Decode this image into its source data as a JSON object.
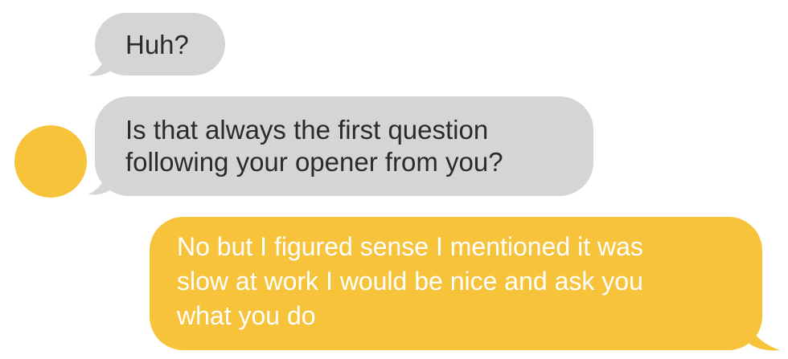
{
  "colors": {
    "received_bubble": "#d5d5d5",
    "sent_bubble": "#f6c33b",
    "avatar": "#f6c33b",
    "sent_text": "#ffffff",
    "received_text": "#2b2b2b"
  },
  "messages": [
    {
      "direction": "received",
      "text": "Huh?"
    },
    {
      "direction": "received",
      "text": "Is that always the first question\nfollowing your opener from you?"
    },
    {
      "direction": "sent",
      "text": "No but I figured sense I mentioned it was\nslow at work I would be nice and ask you\nwhat you do"
    }
  ],
  "avatar": {
    "icon": "avatar-circle"
  }
}
